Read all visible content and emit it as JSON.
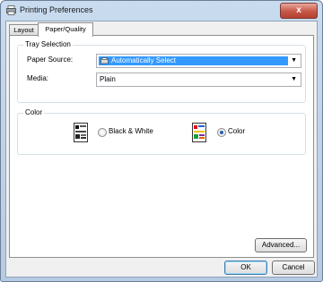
{
  "window": {
    "title": "Printing Preferences",
    "close_label": "x"
  },
  "tabs": [
    {
      "label": "Layout",
      "selected": false
    },
    {
      "label": "Paper/Quality",
      "selected": true
    }
  ],
  "tray_selection": {
    "group_label": "Tray Selection",
    "paper_source_label": "Paper Source:",
    "paper_source_value": "Automatically Select",
    "media_label": "Media:",
    "media_value": "Plain"
  },
  "color": {
    "group_label": "Color",
    "bw_label": "Black & White",
    "color_label": "Color",
    "selected": "Color"
  },
  "buttons": {
    "advanced": "Advanced...",
    "ok": "OK",
    "cancel": "Cancel"
  },
  "colors": {
    "title_bar": "#c9dbee",
    "selection": "#3399ff",
    "close": "#c65746"
  }
}
